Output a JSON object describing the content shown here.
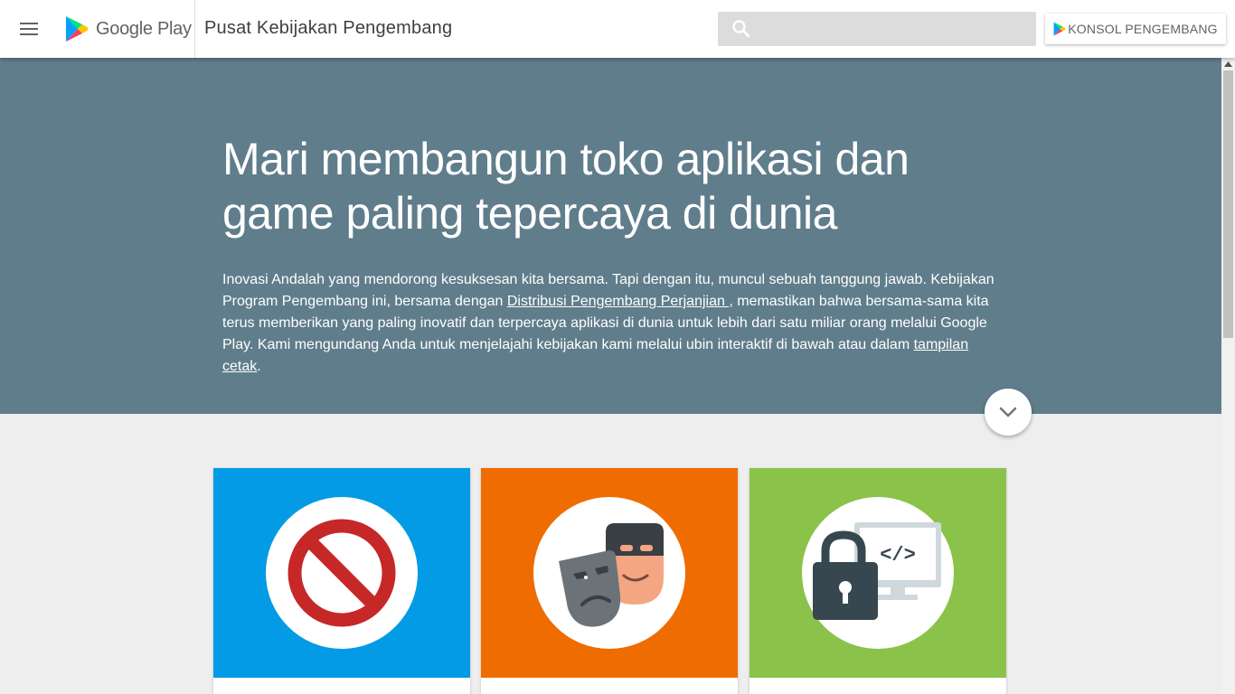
{
  "header": {
    "menu_icon": "hamburger-menu-icon",
    "logo_text": "Google Play",
    "title": "Pusat Kebijakan Pengembang",
    "search_placeholder": "",
    "search_icon": "search-icon",
    "console_button_label": "KONSOL PENGEMBANG"
  },
  "hero": {
    "heading": "Mari membangun toko aplikasi dan game paling tepercaya di dunia",
    "intro_part1": "Inovasi Andalah yang mendorong kesuksesan kita bersama. Tapi dengan itu, muncul sebuah tanggung jawab. Kebijakan Program Pengembang ini, bersama dengan ",
    "link1": "Distribusi Pengembang Perjanjian ",
    "intro_part2": ", memastikan bahwa bersama-sama kita terus memberikan yang paling inovatif dan terpercaya aplikasi di dunia untuk lebih dari satu miliar orang melalui Google Play. Kami mengundang Anda untuk menjelajahi kebijakan kami melalui ubin interaktif di bawah atau dalam ",
    "link2": "tampilan cetak",
    "intro_end": ".",
    "scroll_icon": "chevron-down-icon"
  },
  "cards": [
    {
      "color": "#039be5",
      "icon": "prohibited-icon"
    },
    {
      "color": "#ef6c00",
      "icon": "impersonation-masks-icon"
    },
    {
      "color": "#8bc34a",
      "icon": "security-lock-code-icon"
    }
  ],
  "colors": {
    "hero_bg": "#607d8b",
    "page_bg": "#eeeeee"
  }
}
